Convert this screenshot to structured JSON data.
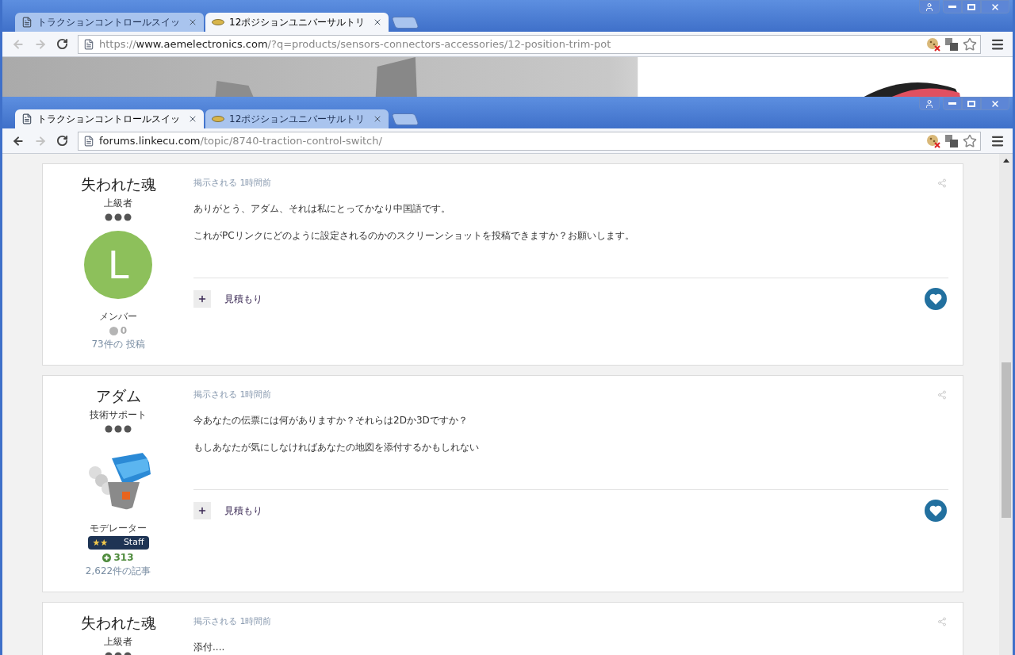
{
  "windows": [
    {
      "tabs": [
        {
          "title": "トラクションコントロールスイッ",
          "selected": false
        },
        {
          "title": "12ポジションユニバーサルトリ",
          "selected": true
        }
      ],
      "nav": {
        "back_enabled": false,
        "forward_enabled": false
      },
      "url": {
        "scheme": "https://",
        "host": "www.aemelectronics.com",
        "path": "/?q=products/sensors-connectors-accessories/12-position-trim-pot"
      },
      "content": {
        "kind": "picture"
      }
    },
    {
      "tabs": [
        {
          "title": "トラクションコントロールスイッ",
          "selected": true
        },
        {
          "title": "12ポジションユニバーサルトリ",
          "selected": false
        }
      ],
      "nav": {
        "back_enabled": true,
        "forward_enabled": false
      },
      "url": {
        "host": "forums.linkecu.com",
        "path": "/topic/8740-traction-control-switch/"
      },
      "content": {
        "kind": "forum",
        "posts": [
          {
            "author": "失われた魂",
            "rank": "上級者",
            "avatar": {
              "kind": "letter",
              "letter": "L",
              "color": "#8dc05b"
            },
            "group": "メンバー",
            "reputation": {
              "kind": "neutral",
              "value": "0"
            },
            "post_count": "73件の 投稿",
            "posted": "掲示される 1時間前",
            "body": [
              "ありがとう、アダム、それは私にとってかなり中国語です。",
              "これがPCリンクにどのように設定されるのかのスクリーンショットを投稿できますか？お願いします。"
            ],
            "quote": "見積もり"
          },
          {
            "author": "アダム",
            "rank": "技術サポート",
            "avatar": {
              "kind": "picture"
            },
            "group": "モデレーター",
            "badge": {
              "symbols": "★★",
              "label": "Staff"
            },
            "reputation": {
              "kind": "positive",
              "value": "313"
            },
            "post_count": "2,622件の記事",
            "posted": "掲示される 1時間前",
            "body": [
              "今あなたの伝票には何がありますか？それらは2Dか3Dですか？",
              "もしあなたが気にしなければあなたの地図を添付するかもしれない"
            ],
            "quote": "見積もり"
          },
          {
            "author": "失われた魂",
            "rank": "上級者",
            "posted": "掲示される 1時間前",
            "body": [
              "添付...."
            ]
          }
        ]
      }
    }
  ]
}
